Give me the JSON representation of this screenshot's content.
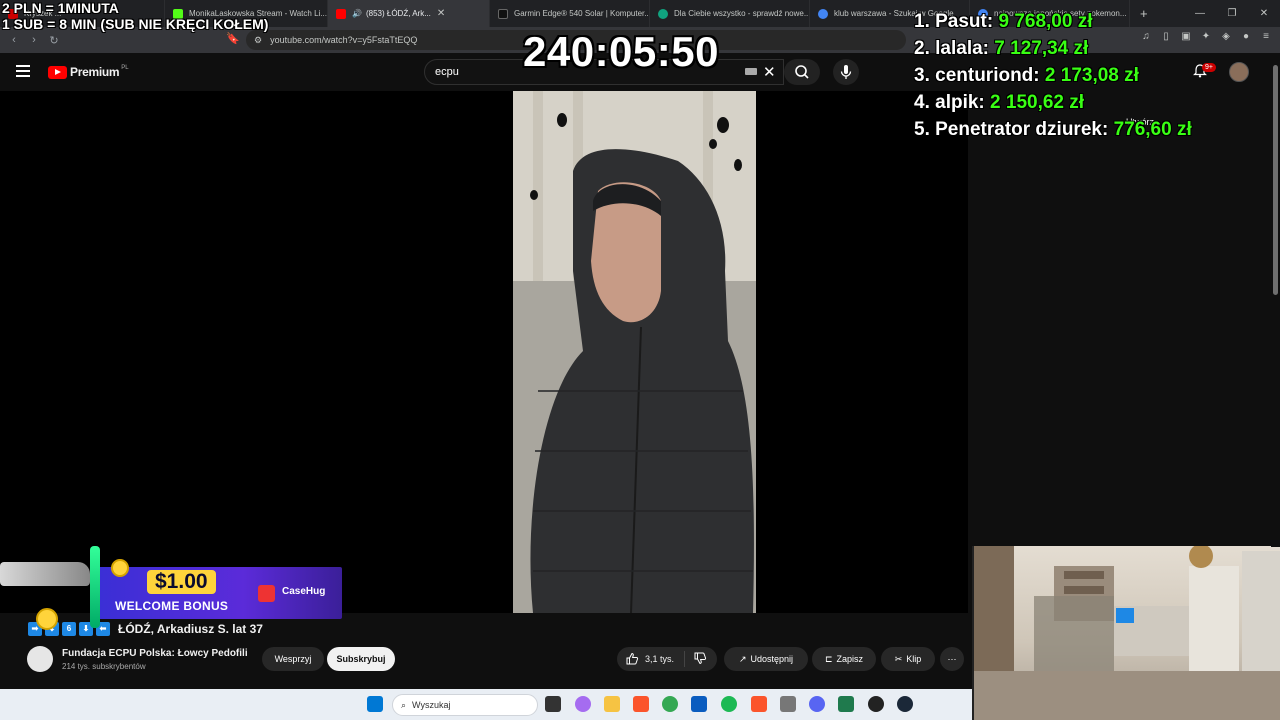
{
  "browser": {
    "tabs": [
      {
        "label": "Kryszek ...",
        "color": "#cc0000"
      },
      {
        "label": "MonikaLaskowska Stream - Watch Li...",
        "color": "#53fc18"
      },
      {
        "label": "(853) ŁÓDŹ, Ark...",
        "color": "#ff0000"
      },
      {
        "label": "Garmin Edge® 540 Solar | Komputer...",
        "color": "#111111"
      },
      {
        "label": "Dla Ciebie wszystko - sprawdź nowe...",
        "color": "#10a37f"
      },
      {
        "label": "klub warszawa - Szukaj w Google",
        "color": "#4285f4"
      },
      {
        "label": "najnowsze japońskie sety pokemon...",
        "color": "#4285f4"
      }
    ],
    "active_tab": 2,
    "url": "youtube.com/watch?v=y5FstaTtEQQ"
  },
  "youtube": {
    "logo_word": "Premium",
    "country": "PL",
    "search_value": "ecpu",
    "create_label": "Utwórz",
    "notif_badge": "9+",
    "video_title": "ŁÓDŹ, Arkadiusz S. lat 37",
    "channel_name": "Fundacja ECPU Polska: Łowcy Pedofili",
    "channel_subs": "214 tys. subskrybentów",
    "support_label": "Wesprzyj",
    "subscribe_label": "Subskrybuj",
    "likes": "3,1 tys.",
    "share_label": "Udostępnij",
    "save_label": "Zapisz",
    "clip_label": "Klip",
    "more_label": "⋯"
  },
  "overlay": {
    "rule1": "2 PLN = 1MINUTA",
    "rule2": "1 SUB = 8 MIN (SUB NIE KRĘCI KOŁEM)",
    "timer": "240:05:50",
    "leaderboard": [
      {
        "name": "1. Pasut:",
        "amount": "9 768,00 zł"
      },
      {
        "name": "2. lalala:",
        "amount": "7 127,34 zł"
      },
      {
        "name": "3. centuriond:",
        "amount": "2 173,08 zł"
      },
      {
        "name": "4. alpik:",
        "amount": "2 150,62 zł"
      },
      {
        "name": "5. Penetrator dziurek:",
        "amount": "776,60 zł"
      }
    ]
  },
  "promo": {
    "amount": "$1.00",
    "subtitle": "WELCOME BONUS",
    "brand": "CaseHug"
  },
  "taskbar": {
    "search_placeholder": "Wyszukaj"
  }
}
